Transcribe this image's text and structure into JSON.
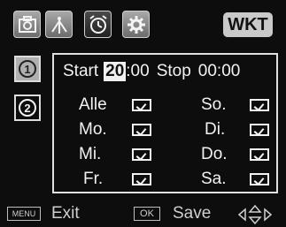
{
  "tabs": [
    {
      "name": "camera-icon"
    },
    {
      "name": "antenna-icon"
    },
    {
      "name": "alarm-clock-icon"
    },
    {
      "name": "gear-icon"
    }
  ],
  "header": {
    "badge": "WKT"
  },
  "side": {
    "items": [
      "1",
      "2"
    ]
  },
  "schedule": {
    "start_label": "Start",
    "start_hour": "20",
    "start_min": ":00",
    "stop_label": "Stop",
    "stop_time": "00:00"
  },
  "days": {
    "alle": "Alle",
    "mo": "Mo.",
    "mi": "Mi.",
    "fr": "Fr.",
    "so": "So.",
    "di": "Di.",
    "do": "Do.",
    "sa": "Sa."
  },
  "footer": {
    "menu": "MENU",
    "exit": "Exit",
    "ok": "OK",
    "save": "Save"
  }
}
